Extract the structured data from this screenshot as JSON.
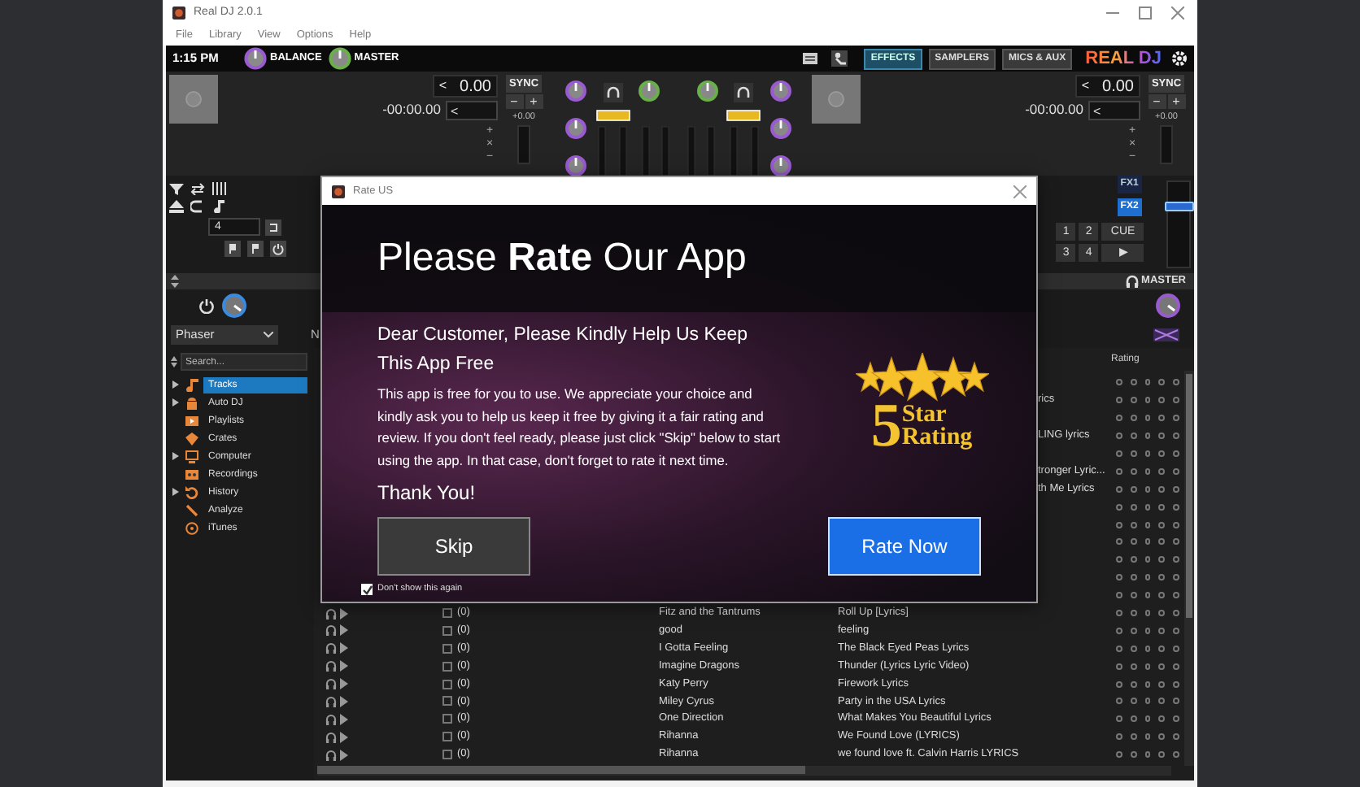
{
  "window": {
    "title": "Real DJ 2.0.1"
  },
  "menu": [
    "File",
    "Library",
    "View",
    "Options",
    "Help"
  ],
  "top_bar": {
    "clock": "1:15 PM",
    "knobs": [
      {
        "label": "BALANCE"
      },
      {
        "label": "MASTER"
      }
    ],
    "tabs": [
      {
        "label": "EFFECTS",
        "selected": true
      },
      {
        "label": "SAMPLERS",
        "selected": false
      },
      {
        "label": "MICS & AUX",
        "selected": false
      }
    ],
    "logo": "REAL DJ"
  },
  "decks": [
    {
      "pitch_arrow": "<",
      "pitch": "0.00",
      "time": "-00:00.00",
      "time_arrow": "<",
      "sync": "SYNC",
      "minus": "−",
      "plus": "+",
      "offset": "+0.00",
      "zoom": [
        "+",
        "×",
        "−"
      ]
    },
    {
      "pitch_arrow": "<",
      "pitch": "0.00",
      "time": "-00:00.00",
      "time_arrow": "<",
      "sync": "SYNC",
      "minus": "−",
      "plus": "+",
      "offset": "+0.00",
      "zoom": [
        "+",
        "×",
        "−"
      ]
    }
  ],
  "loop": {
    "value": "4"
  },
  "right_controls": {
    "fx": [
      {
        "label": "FX1",
        "selected": false
      },
      {
        "label": "FX2",
        "selected": true
      }
    ],
    "pads": [
      "1",
      "2",
      "3",
      "4"
    ],
    "cue": "CUE",
    "play": "▶",
    "fader": {
      "level": 0.75
    }
  },
  "master": {
    "label": "MASTER"
  },
  "effect_select": {
    "value": "Phaser"
  },
  "effect_select_2": {
    "value": "N"
  },
  "search": {
    "placeholder": "Search..."
  },
  "tree": [
    {
      "label": "Tracks",
      "kind": "note",
      "collapsible": true,
      "selected": true
    },
    {
      "label": "Auto DJ",
      "kind": "robot",
      "collapsible": true,
      "selected": false
    },
    {
      "label": "Playlists",
      "kind": "list",
      "collapsible": false,
      "selected": false
    },
    {
      "label": "Crates",
      "kind": "crate",
      "collapsible": false,
      "selected": false
    },
    {
      "label": "Computer",
      "kind": "monitor",
      "collapsible": true,
      "selected": false
    },
    {
      "label": "Recordings",
      "kind": "tape",
      "collapsible": false,
      "selected": false
    },
    {
      "label": "History",
      "kind": "history",
      "collapsible": true,
      "selected": false
    },
    {
      "label": "Analyze",
      "kind": "wand",
      "collapsible": false,
      "selected": false
    },
    {
      "label": "iTunes",
      "kind": "disc",
      "collapsible": false,
      "selected": false
    }
  ],
  "table": {
    "columns": [
      {
        "label": "Rating"
      }
    ],
    "rows": [
      {
        "kind": "partial",
        "stars": 0
      },
      {
        "kind": "partial",
        "title": "rics",
        "stars": 0
      },
      {
        "kind": "partial",
        "stars": 0
      },
      {
        "kind": "partial",
        "title": "LING lyrics",
        "stars": 0
      },
      {
        "kind": "partial",
        "stars": 0
      },
      {
        "kind": "partial",
        "title": "tronger Lyric...",
        "stars": 0
      },
      {
        "kind": "partial",
        "title": "th Me Lyrics",
        "stars": 0
      },
      {
        "kind": "partial",
        "stars": 0
      },
      {
        "kind": "partial",
        "stars": 0
      },
      {
        "kind": "partial",
        "stars": 0
      },
      {
        "kind": "partial",
        "stars": 0
      },
      {
        "kind": "partial",
        "stars": 0
      },
      {
        "kind": "partial",
        "stars": 0
      },
      {
        "kind": "full",
        "checked": false,
        "count": "(0)",
        "artist": "Fitz and the Tantrums",
        "title": "Roll Up [Lyrics]",
        "stars": 0
      },
      {
        "kind": "full",
        "checked": false,
        "count": "(0)",
        "artist": "good",
        "title": "feeling",
        "stars": 0
      },
      {
        "kind": "full",
        "checked": false,
        "count": "(0)",
        "artist": "I Gotta Feeling",
        "title": "The Black Eyed Peas Lyrics",
        "stars": 0
      },
      {
        "kind": "full",
        "checked": false,
        "count": "(0)",
        "artist": "Imagine Dragons",
        "title": "Thunder (Lyrics  Lyric Video)",
        "stars": 0
      },
      {
        "kind": "full",
        "checked": false,
        "count": "(0)",
        "artist": "Katy Perry",
        "title": "Firework Lyrics",
        "stars": 0
      },
      {
        "kind": "full",
        "checked": false,
        "count": "(0)",
        "artist": "Miley Cyrus",
        "title": "Party in the USA Lyrics",
        "stars": 0
      },
      {
        "kind": "full",
        "checked": false,
        "count": "(0)",
        "artist": "One Direction",
        "title": "What Makes You Beautiful Lyrics",
        "stars": 0
      },
      {
        "kind": "full",
        "checked": false,
        "count": "(0)",
        "artist": "Rihanna",
        "title": "We Found Love (LYRICS)",
        "stars": 0
      },
      {
        "kind": "full",
        "checked": false,
        "count": "(0)",
        "artist": "Rihanna",
        "title": "we found love ft. Calvin Harris LYRICS",
        "stars": 0
      }
    ]
  },
  "dialog": {
    "title": "Rate US",
    "heading": "Please **Rate** Our App",
    "subheading": "Dear Customer, Please Kindly Help Us Keep This App Free",
    "body": "This app is free for you to use. We appreciate your choice and kindly ask you to help us keep it free by giving it a fair rating and review. If you don't feel ready, please just click \"Skip\" below to start using the app. In that case, don't forget to rate it next time.",
    "thanks": "Thank You!",
    "badge": {
      "number": "5",
      "line_1": "Star",
      "line_2": "Rating"
    },
    "buttons": [
      {
        "label": "Skip",
        "kind": "secondary"
      },
      {
        "label": "Rate Now",
        "kind": "primary"
      }
    ],
    "dont_show": {
      "label": "Don't show this again",
      "checked": true
    }
  }
}
